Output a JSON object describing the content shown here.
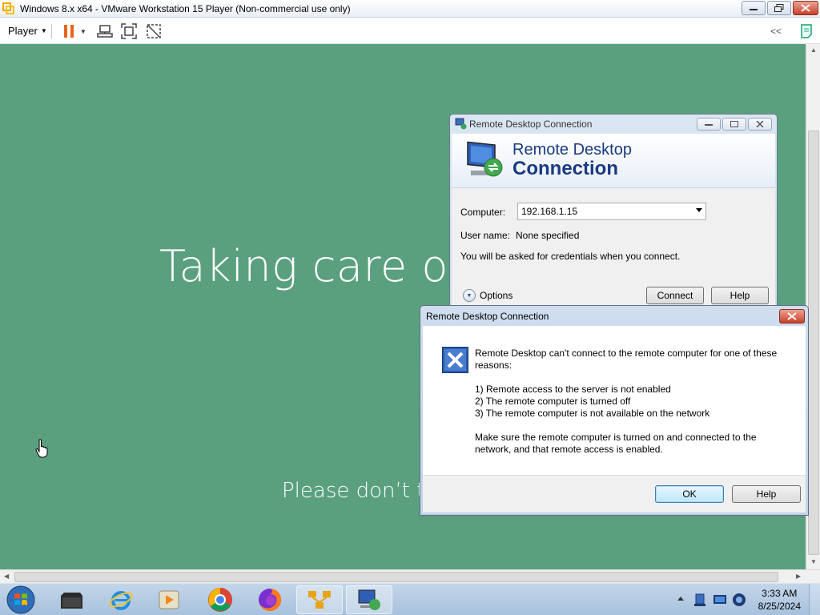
{
  "vmware": {
    "title": "Windows 8.x x64 - VMware Workstation 15 Player (Non-commercial use only)",
    "player_menu": "Player",
    "toolbar_icons": [
      "pause-icon",
      "dropdown-icon",
      "send-ctrl-alt-del-icon",
      "fullscreen-icon",
      "unity-icon"
    ],
    "collapse_label": "<<"
  },
  "guest": {
    "big_text": "Taking care of a",
    "small_text": "Please don’t tur",
    "background": "#5aa07f"
  },
  "rdc_window": {
    "title": "Remote Desktop Connection",
    "header_line1": "Remote Desktop",
    "header_line2": "Connection",
    "computer_label": "Computer:",
    "computer_value": "192.168.1.15",
    "username_label": "User name:",
    "username_value": "None specified",
    "credentials_note": "You will be asked for credentials when you connect.",
    "options_label": "Options",
    "connect_button": "Connect",
    "help_button": "Help"
  },
  "error_dialog": {
    "title": "Remote Desktop Connection",
    "line1": "Remote Desktop can't connect to the remote computer for one of these",
    "line2": "reasons:",
    "reason1": "1) Remote access to the server is not enabled",
    "reason2": "2) The remote computer is turned off",
    "reason3": "3) The remote computer is not available on the network",
    "advice1": "Make sure the remote computer is turned on and connected to the",
    "advice2": "network, and that remote access is enabled.",
    "ok_button": "OK",
    "help_button": "Help"
  },
  "taskbar": {
    "apps": [
      "windows-explorer-folder",
      "internet-explorer",
      "media-player",
      "chrome",
      "firefox",
      "network-app",
      "remote-desktop"
    ],
    "time": "3:33 AM",
    "date": "8/25/2024"
  }
}
